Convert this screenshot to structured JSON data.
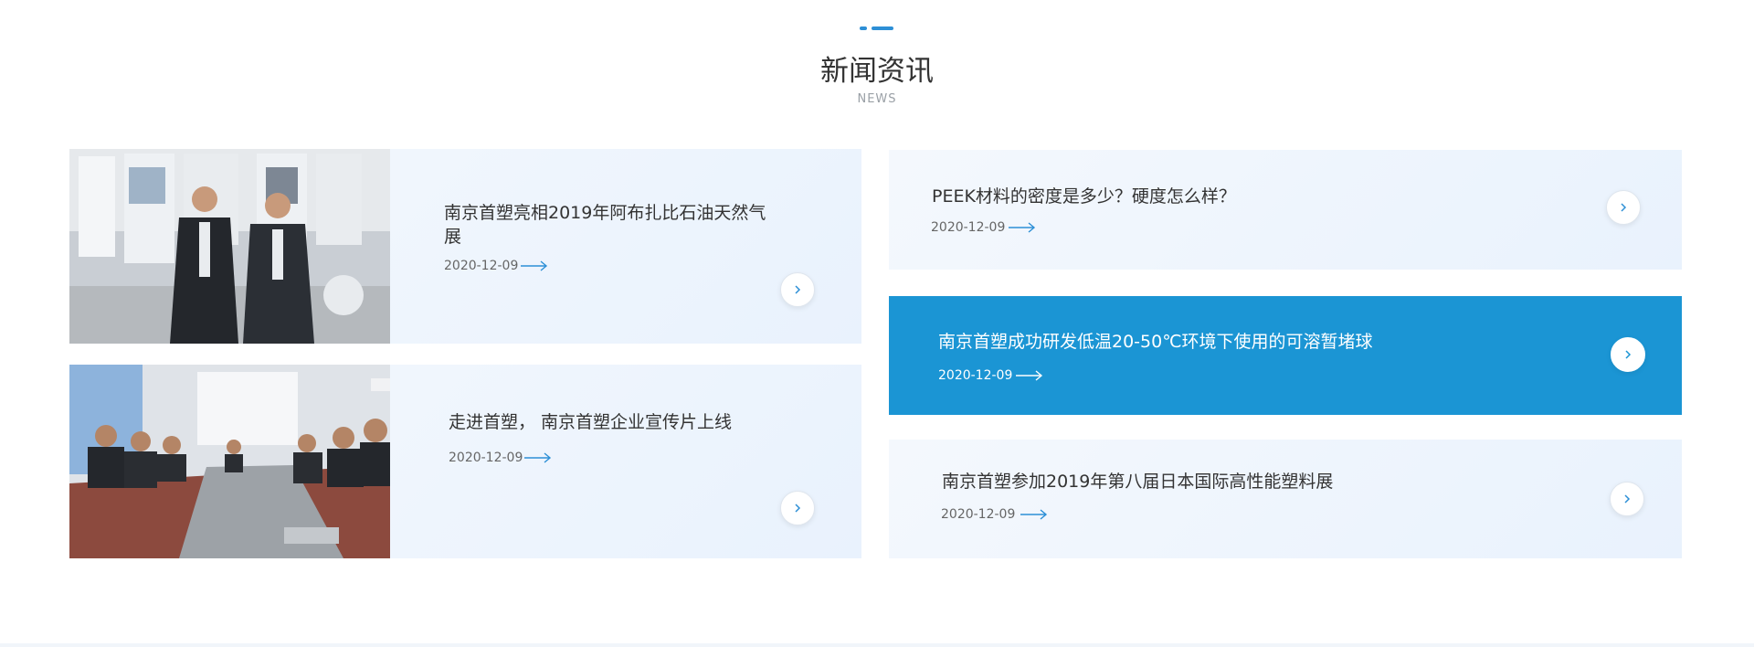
{
  "section": {
    "title": "新闻资讯",
    "subtitle": "NEWS"
  },
  "left_news": [
    {
      "title": "南京首塑亮相2019年阿布扎比石油天然气展",
      "date": "2020-12-09"
    },
    {
      "title": "走进首塑， 南京首塑企业宣传片上线",
      "date": "2020-12-09"
    }
  ],
  "right_news": [
    {
      "title": "PEEK材料的密度是多少？硬度怎么样？",
      "date": "2020-12-09",
      "active": false
    },
    {
      "title": "南京首塑成功研发低温20-50℃环境下使用的可溶暂堵球",
      "date": "2020-12-09",
      "active": true
    },
    {
      "title": "南京首塑参加2019年第八届日本国际高性能塑料展",
      "date": "2020-12-09",
      "active": false
    }
  ],
  "colors": {
    "accent": "#1b95d4",
    "card_bg": "#eef5fd",
    "arrow": "#2d8fd6"
  },
  "icons": {
    "date_arrow": "long-right-arrow-icon",
    "more": "chevron-right-icon"
  }
}
